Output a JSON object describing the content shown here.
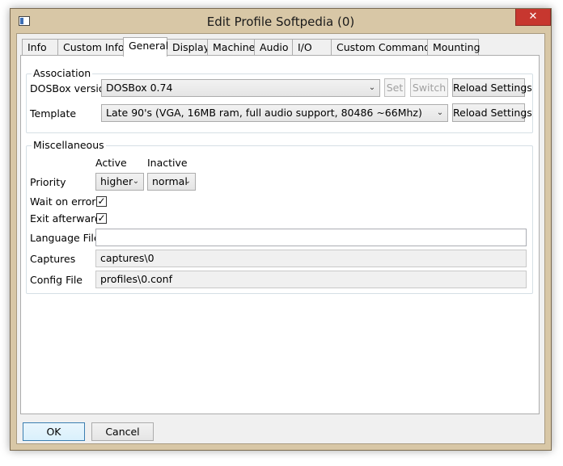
{
  "window": {
    "title": "Edit Profile Softpedia (0)",
    "close_glyph": "✕"
  },
  "tabs": [
    {
      "label": "Info"
    },
    {
      "label": "Custom Info"
    },
    {
      "label": "General"
    },
    {
      "label": "Display"
    },
    {
      "label": "Machine"
    },
    {
      "label": "Audio"
    },
    {
      "label": "I/O"
    },
    {
      "label": "Custom Commands"
    },
    {
      "label": "Mounting"
    }
  ],
  "association": {
    "title": "Association",
    "dosbox_version_label": "DOSBox version",
    "dosbox_version_value": "DOSBox 0.74",
    "set_label": "Set",
    "switch_label": "Switch",
    "reload_label": "Reload Settings",
    "template_label": "Template",
    "template_value": "Late  90's (VGA, 16MB ram, full audio support, 80486 ~66Mhz)",
    "reload2_label": "Reload Settings"
  },
  "misc": {
    "title": "Miscellaneous",
    "active_label": "Active",
    "inactive_label": "Inactive",
    "priority_label": "Priority",
    "priority_active": "higher",
    "priority_inactive": "normal",
    "wait_on_error_label": "Wait on error",
    "wait_on_error_checked": true,
    "exit_afterwards_label": "Exit afterwards",
    "exit_afterwards_checked": true,
    "language_file_label": "Language File",
    "language_file_value": "",
    "captures_label": "Captures",
    "captures_value": "captures\\0",
    "config_file_label": "Config File",
    "config_file_value": "profiles\\0.conf"
  },
  "footer": {
    "ok_label": "OK",
    "cancel_label": "Cancel"
  },
  "glyphs": {
    "dropdown": "⌄",
    "check": "✓"
  }
}
